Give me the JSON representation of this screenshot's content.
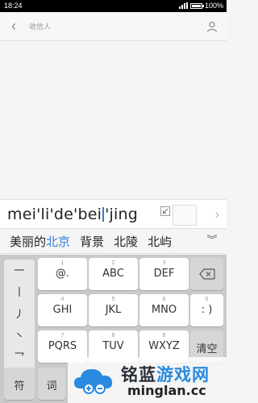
{
  "status_bar": {
    "time": "18:24",
    "battery": "100%"
  },
  "recipient": {
    "placeholder": "收信人"
  },
  "compose": {
    "text_before": "mei'li'de'bei",
    "text_after": "'jing"
  },
  "candidates": [
    {
      "text_normal": "美丽的",
      "text_highlight": "北京"
    },
    {
      "text_normal": "背景",
      "text_highlight": ""
    },
    {
      "text_normal": "北陵",
      "text_highlight": ""
    },
    {
      "text_normal": "北屿",
      "text_highlight": ""
    }
  ],
  "keyboard": {
    "strokes": [
      "一",
      "丨",
      "丿",
      "丶",
      "乛"
    ],
    "keys": [
      {
        "num": "1",
        "label": "@."
      },
      {
        "num": "2",
        "label": "ABC"
      },
      {
        "num": "3",
        "label": "DEF"
      },
      {
        "num": "4",
        "label": "GHI"
      },
      {
        "num": "5",
        "label": "JKL"
      },
      {
        "num": "6",
        "label": "MNO"
      },
      {
        "num": "7",
        "label": "PQRS"
      },
      {
        "num": "8",
        "label": "TUV"
      },
      {
        "num": "9",
        "label": "WXYZ"
      }
    ],
    "zero_key": {
      "num": "0",
      "label": ": )"
    },
    "clear_label": "清空",
    "symbol_label": "符",
    "phrase_label": "词"
  },
  "watermark": {
    "title_a": "铭蓝",
    "title_b": "游戏网",
    "url": "minglan.cc"
  },
  "colors": {
    "accent": "#2f7fd8",
    "highlight_text": "#2f7fd8",
    "keyboard_bg": "#c9c9c9"
  }
}
